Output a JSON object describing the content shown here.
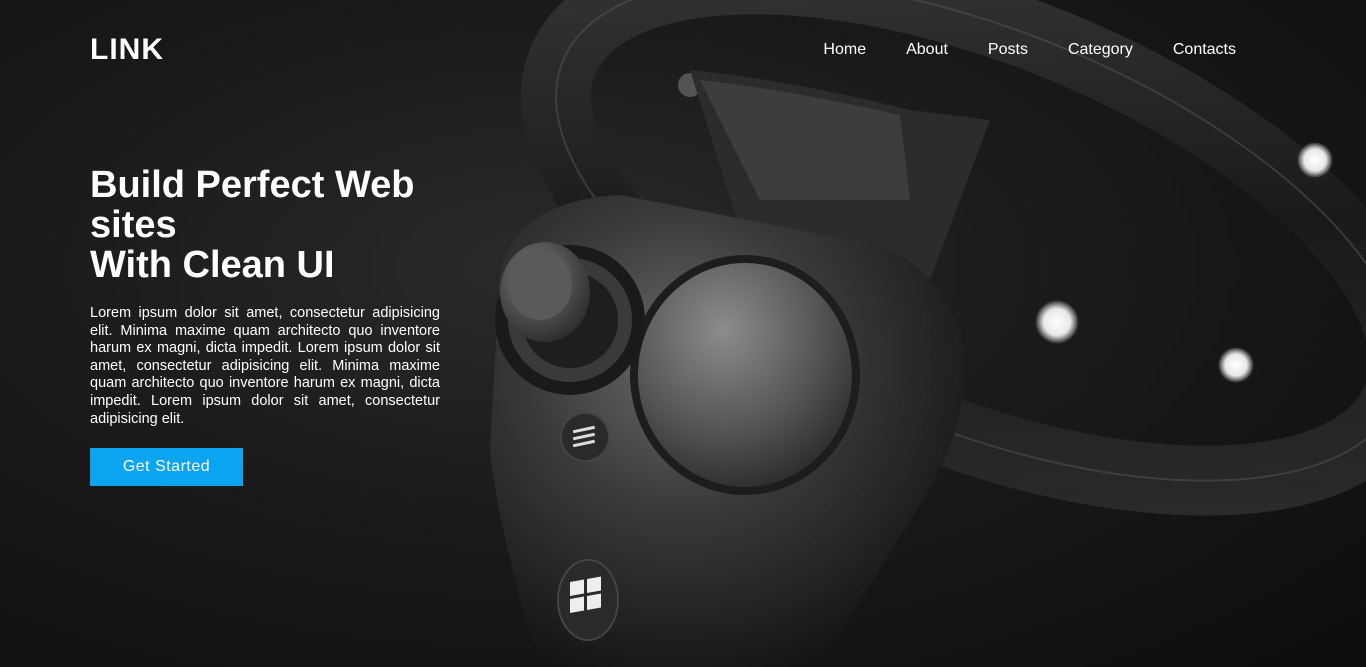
{
  "brand": {
    "logo": "LINK"
  },
  "nav": {
    "items": [
      {
        "label": "Home"
      },
      {
        "label": "About"
      },
      {
        "label": "Posts"
      },
      {
        "label": "Category"
      },
      {
        "label": "Contacts"
      }
    ]
  },
  "hero": {
    "title_line1": "Build Perfect Web",
    "title_line2": "sites",
    "title_line3": "With Clean UI",
    "description": "Lorem ipsum dolor sit amet, consectetur adipisicing elit. Minima maxime quam architecto quo inventore harum ex magni, dicta impedit. Lorem ipsum dolor sit amet, consectetur adipisicing elit. Minima maxime quam architecto quo inventore harum ex magni, dicta impedit. Lorem ipsum dolor sit amet, consectetur adipisicing elit.",
    "cta_label": "Get Started",
    "image_icon": "vr-controller-image"
  },
  "colors": {
    "accent": "#0ba4f0",
    "background": "#111111",
    "text": "#ffffff"
  }
}
